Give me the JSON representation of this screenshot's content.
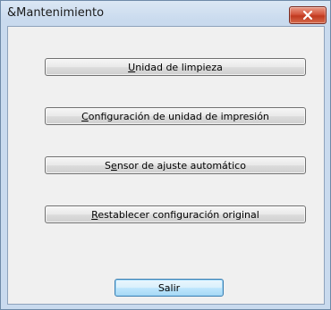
{
  "window": {
    "title": "&Mantenimiento"
  },
  "buttons": [
    {
      "pre": "",
      "mn": "U",
      "post": "nidad de limpieza"
    },
    {
      "pre": "",
      "mn": "C",
      "post": "onfiguración de unidad de impresión"
    },
    {
      "pre": "S",
      "mn": "e",
      "post": "nsor de ajuste automático"
    },
    {
      "pre": "",
      "mn": "R",
      "post": "establecer configuración original"
    }
  ],
  "exit_button": {
    "label": "Salir"
  },
  "colors": {
    "close_button": "#c0391f",
    "dialog_background": "#f0f0f0",
    "frame": "#c9daee"
  }
}
